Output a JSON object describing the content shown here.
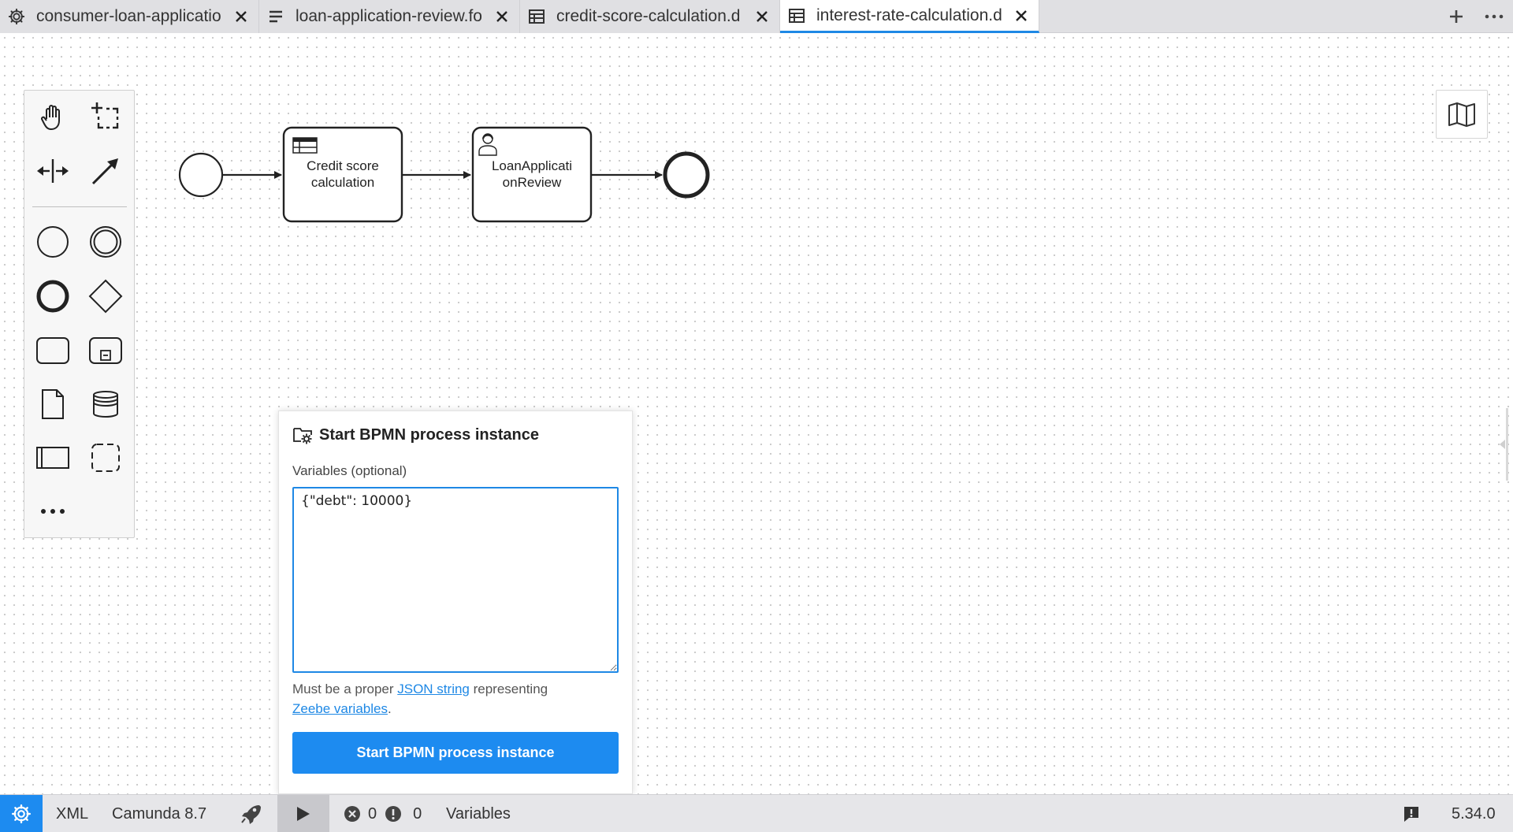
{
  "tabs": [
    {
      "label": "consumer-loan-applicatio",
      "icon": "gear-icon",
      "active": false
    },
    {
      "label": "loan-application-review.fo",
      "icon": "form-icon",
      "active": false
    },
    {
      "label": "credit-score-calculation.d",
      "icon": "table-icon",
      "active": false
    },
    {
      "label": "interest-rate-calculation.d",
      "icon": "table-icon",
      "active": true
    }
  ],
  "tabbar_actions": [
    "plus-icon",
    "more-icon"
  ],
  "palette": {
    "tools": [
      "hand-tool",
      "lasso-tool",
      "space-tool",
      "connect-tool",
      "start-event",
      "intermediate-event",
      "end-event",
      "gateway",
      "task",
      "subprocess",
      "data-object",
      "data-store",
      "pool",
      "group",
      "more-tools"
    ]
  },
  "diagram": {
    "tasks": [
      {
        "label_line1": "Credit score",
        "label_line2": "calculation",
        "type": "business-rule-task"
      },
      {
        "label_line1": "LoanApplicati",
        "label_line2": "onReview",
        "type": "user-task"
      }
    ]
  },
  "dialog": {
    "title": "Start BPMN process instance",
    "variables_label": "Variables (optional)",
    "variables_value": "{\"debt\": 10000}",
    "help_prefix": "Must be a proper ",
    "help_link1": "JSON string",
    "help_middle": " representing",
    "help_link2": "Zeebe variables",
    "help_suffix": ".",
    "submit_label": "Start BPMN process instance"
  },
  "statusbar": {
    "xml_label": "XML",
    "engine_label": "Camunda 8.7",
    "error_count": "0",
    "warning_count": "0",
    "variables_label": "Variables",
    "version": "5.34.0"
  },
  "colors": {
    "accent": "#1d8bf0",
    "tab_bar": "#e0e0e3",
    "status_bar": "#e6e6e9"
  }
}
